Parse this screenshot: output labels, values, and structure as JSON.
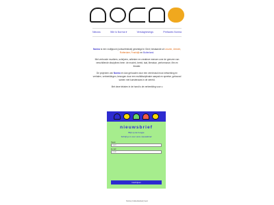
{
  "logo": {
    "letters": [
      "n",
      "o",
      "r",
      "m",
      "a"
    ],
    "colors": {
      "a": "#f0a81e",
      "o": "#ffffff"
    }
  },
  "nav": [
    {
      "label": "Nieuws"
    },
    {
      "label": "Wie is Norma ▾"
    },
    {
      "label": "Verslaghevings"
    },
    {
      "label": "Prefacies Norma"
    }
  ],
  "intro": {
    "p1_brand": "Norma",
    "p1_text": " is een vrolijkpunt (cultuurfestival) gevestigd in Gent; bestaande uit",
    "p1_link1": "Leuven, Utrecht, Rotterdam, Frankrijk",
    "p1_and": " en ",
    "p1_link2": "Buitenland",
    "p1_end": ".",
    "p2": "Met verbonde muzikers, schrijvers, artiesten en creatieve mensen over de grenzen van verschillende disciplines heen: de muziek, beeld, taal, literatuur, performance, film en theater.",
    "p3_pre": "De projecten van ",
    "p3_brand": "Norma",
    "p3_text": " en dan gehouden door een vernieuwd mooi netwerking en verhalen, verbeeldingen, bewogen door een multidisciplinaire aanpak en speelse, gebouwd samen met kunstenaars in de wereld.",
    "p4": "Met deze teksten in de hand is de verbeelding voor u"
  },
  "newsletter": {
    "title": "nieuwsbrief",
    "sub1": "Blijf op de hoogte",
    "sub2": "Schrijf je in voor onze nieuwsbrief",
    "name_label": "Naam",
    "name_placeholder": "naam",
    "email_label": "E-mail",
    "email_placeholder": "email",
    "submit": "Inschrijven",
    "colors": {
      "bg": "#a6ed8d",
      "accent": "#2d2bd0"
    }
  },
  "footer": "Norma | Cultuurfestival | Gent"
}
